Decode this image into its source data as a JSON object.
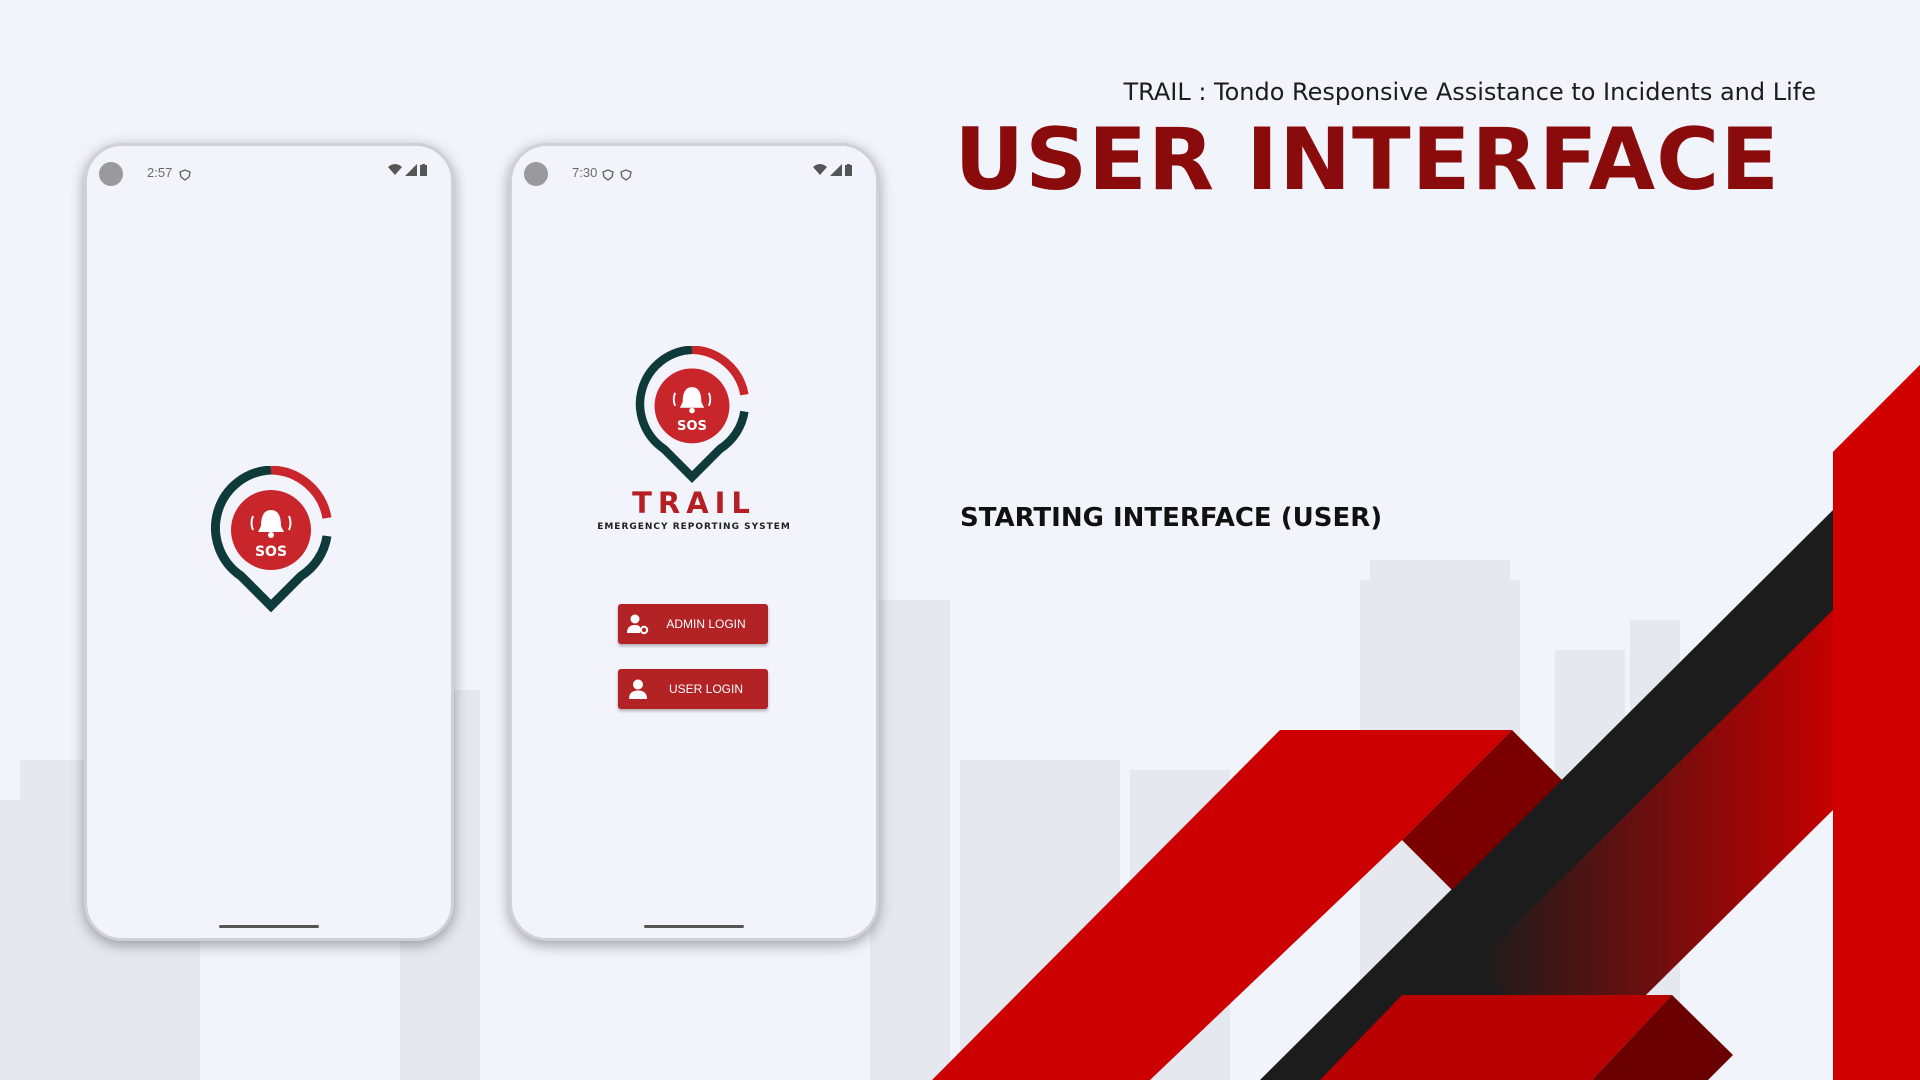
{
  "slide": {
    "subtitle": "TRAIL : Tondo Responsive Assistance to Incidents and Life",
    "title": "USER INTERFACE",
    "section_label": "STARTING INTERFACE (USER)"
  },
  "phone_splash": {
    "time": "2:57",
    "logo_text": "SOS"
  },
  "phone_login": {
    "time": "7:30",
    "logo_text": "SOS",
    "brand_name": "TRAIL",
    "brand_tagline": "EMERGENCY REPORTING SYSTEM",
    "admin_button": "ADMIN LOGIN",
    "user_button": "USER LOGIN"
  },
  "colors": {
    "accent_dark_red": "#8a0b0b",
    "button_red": "#b32326",
    "logo_teal": "#0f3a3a",
    "deco_red": "#cc0000",
    "deco_black": "#1c1c1c"
  },
  "icons": [
    "camera-icon",
    "wifi-icon",
    "signal-icon",
    "battery-icon",
    "vpn-icon",
    "bell-icon",
    "admin-user-icon",
    "user-icon"
  ]
}
